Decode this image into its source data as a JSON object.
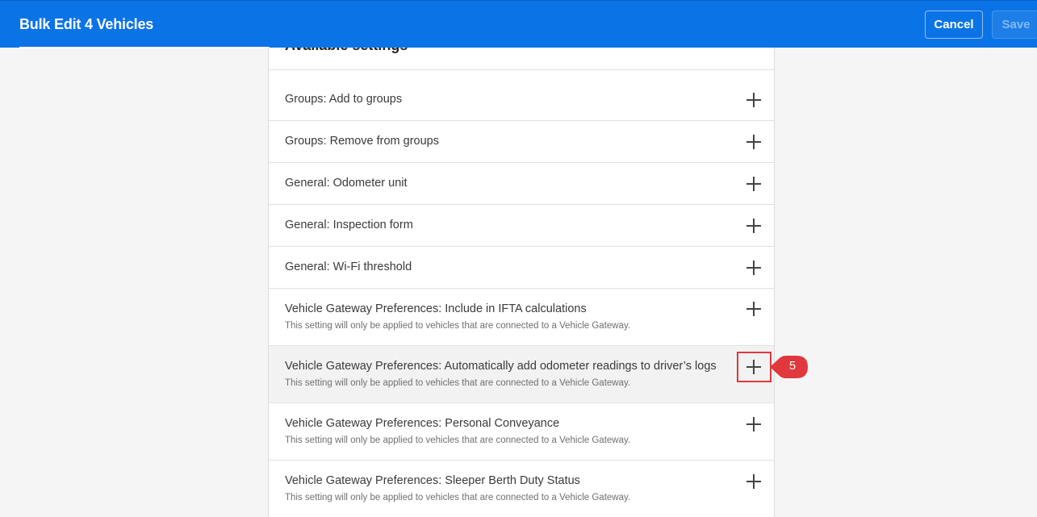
{
  "header": {
    "title": "Bulk Edit 4 Vehicles",
    "cancel_label": "Cancel",
    "save_label": "Save"
  },
  "panel": {
    "heading": "Available settings",
    "rows": [
      {
        "label": "Groups: Add to groups",
        "sub": ""
      },
      {
        "label": "Groups: Remove from groups",
        "sub": ""
      },
      {
        "label": "General: Odometer unit",
        "sub": ""
      },
      {
        "label": "General: Inspection form",
        "sub": ""
      },
      {
        "label": "General: Wi-Fi threshold",
        "sub": ""
      },
      {
        "label": "Vehicle Gateway Preferences: Include in IFTA calculations",
        "sub": "This setting will only be applied to vehicles that are connected to a Vehicle Gateway."
      },
      {
        "label": "Vehicle Gateway Preferences: Automatically add odometer readings to driver’s logs",
        "sub": "This setting will only be applied to vehicles that are connected to a Vehicle Gateway."
      },
      {
        "label": "Vehicle Gateway Preferences: Personal Conveyance",
        "sub": "This setting will only be applied to vehicles that are connected to a Vehicle Gateway."
      },
      {
        "label": "Vehicle Gateway Preferences: Sleeper Berth Duty Status",
        "sub": "This setting will only be applied to vehicles that are connected to a Vehicle Gateway."
      }
    ],
    "add_icon": "plus-icon"
  },
  "annotation": {
    "step_number": "5",
    "color": "#e0383d"
  },
  "colors": {
    "header_bg": "#0a73e6",
    "hover_row_bg": "#f2f2f2"
  }
}
